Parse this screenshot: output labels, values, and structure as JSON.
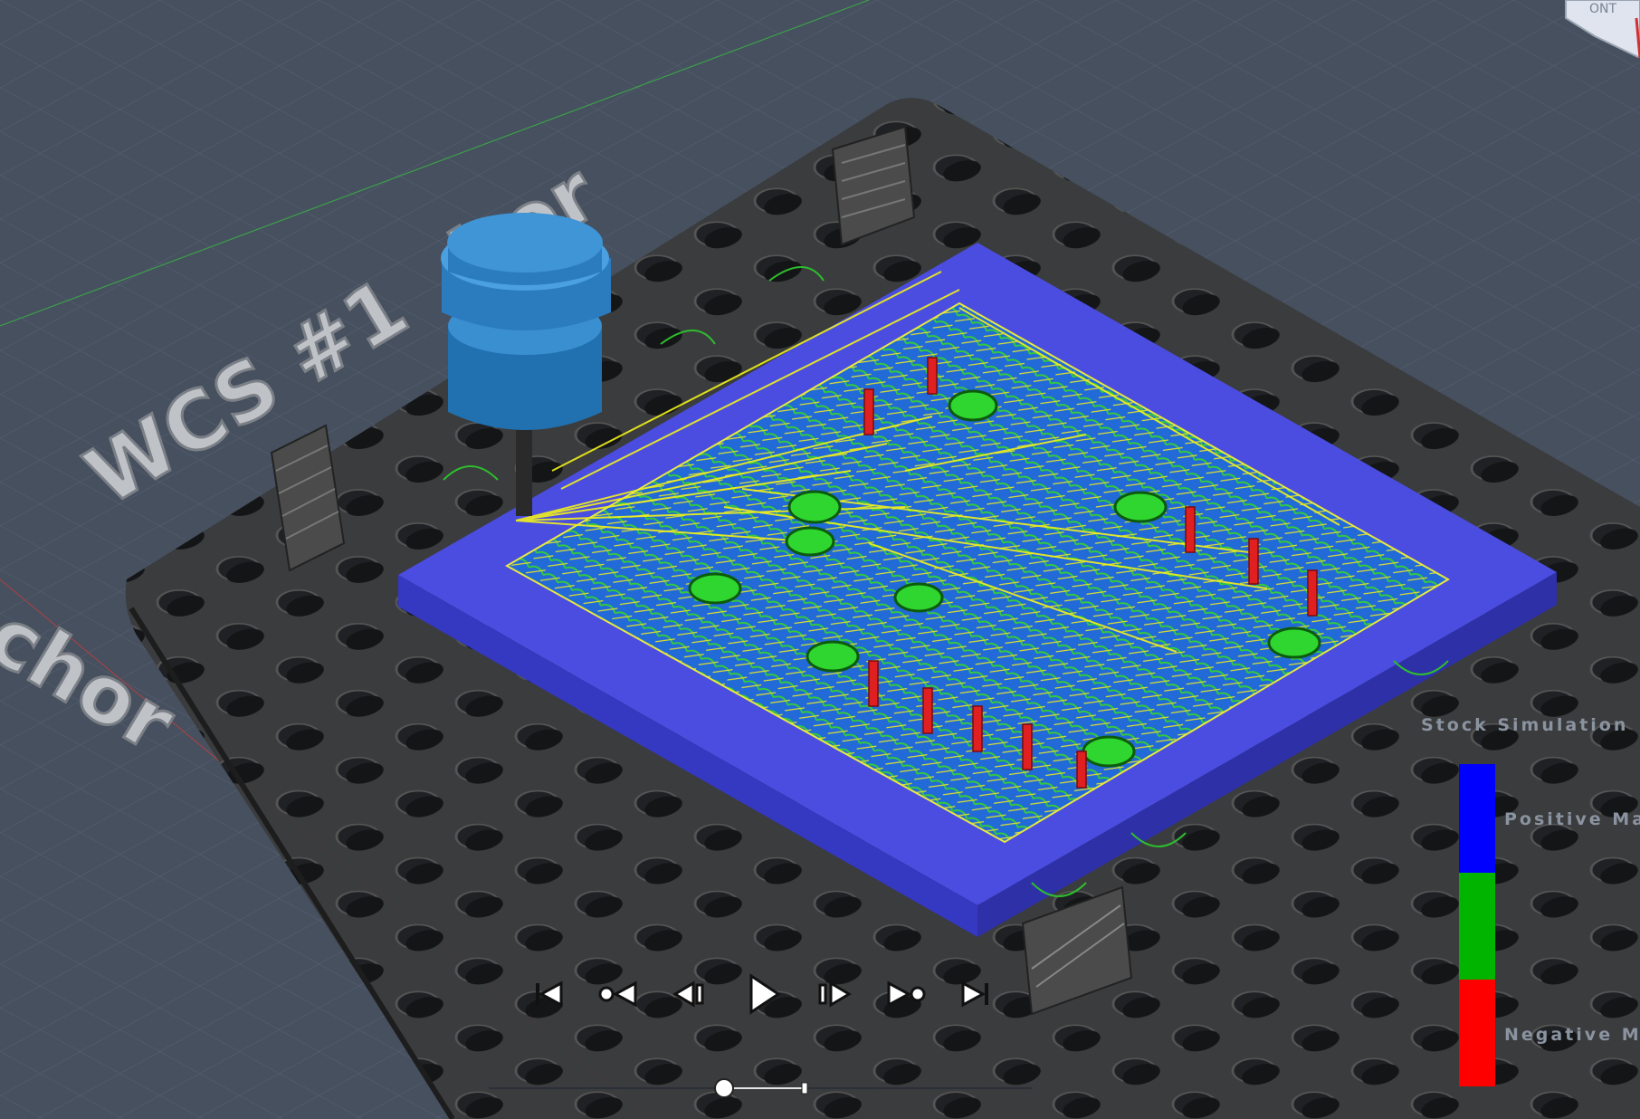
{
  "workspace": {
    "wcs_label": "WCS #1",
    "anchor_fragment": "hor",
    "anchor_fragment_side": "chor"
  },
  "viewcube": {
    "face_label": "ONT"
  },
  "playback": {
    "buttons": [
      {
        "name": "go-to-start-button",
        "icon": "skip-to-start-icon"
      },
      {
        "name": "previous-operation-button",
        "icon": "previous-marker-icon"
      },
      {
        "name": "step-back-button",
        "icon": "step-back-icon"
      },
      {
        "name": "play-button",
        "icon": "play-icon"
      },
      {
        "name": "step-forward-button",
        "icon": "step-forward-icon"
      },
      {
        "name": "next-operation-button",
        "icon": "next-marker-icon"
      },
      {
        "name": "go-to-end-button",
        "icon": "skip-to-end-icon"
      }
    ],
    "timeline_position": 0.38
  },
  "legend": {
    "title": "Stock Simulation",
    "positive_label": "Positive Mat",
    "negative_label": "Negative Mat",
    "colors": {
      "positive": "#0000ff",
      "neutral": "#00b400",
      "negative": "#ff0000"
    }
  },
  "colors": {
    "background": "#46505f",
    "fixture_plate": "#3a3a3a",
    "stock": "#4a4de0",
    "tool": "#2b7bbf",
    "toolpath_yellow": "#f0f000",
    "toolpath_green": "#2fd02f",
    "toolpath_blue": "#2030ff"
  }
}
